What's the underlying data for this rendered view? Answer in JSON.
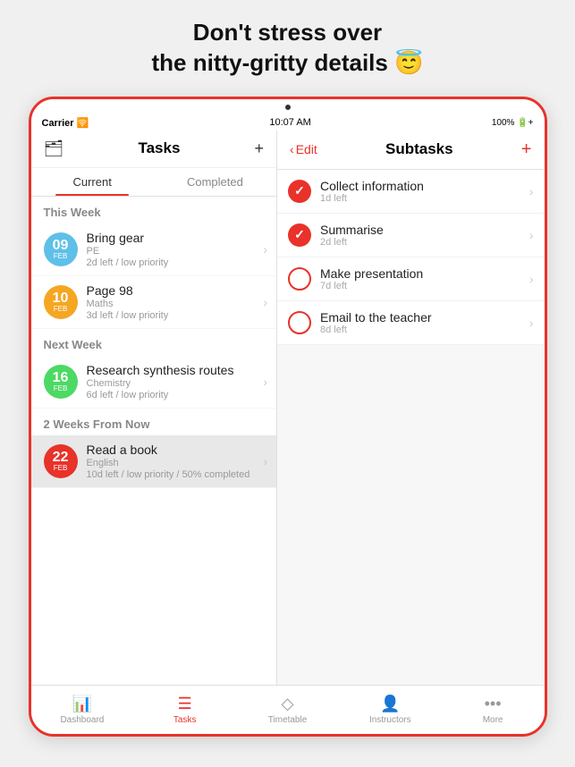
{
  "headline": {
    "line1": "Don't stress over",
    "line2": "the nitty-gritty details 😇"
  },
  "status_bar": {
    "carrier": "Carrier 🛜",
    "time": "10:07 AM",
    "battery": "100% 🔋+"
  },
  "left_panel": {
    "title": "Tasks",
    "tabs": [
      {
        "label": "Current",
        "active": true
      },
      {
        "label": "Completed",
        "active": false
      }
    ],
    "sections": [
      {
        "heading": "This Week",
        "tasks": [
          {
            "day": "09",
            "month": "Feb",
            "color": "#5ec0e8",
            "title": "Bring gear",
            "subtitle": "PE",
            "detail": "2d left / low priority"
          },
          {
            "day": "10",
            "month": "Feb",
            "color": "#f5a623",
            "title": "Page 98",
            "subtitle": "Maths",
            "detail": "3d left / low priority"
          }
        ]
      },
      {
        "heading": "Next Week",
        "tasks": [
          {
            "day": "16",
            "month": "Feb",
            "color": "#4cd964",
            "title": "Research synthesis routes",
            "subtitle": "Chemistry",
            "detail": "6d left / low priority"
          }
        ]
      },
      {
        "heading": "2 Weeks From Now",
        "tasks": [
          {
            "day": "22",
            "month": "Feb",
            "color": "#e8322a",
            "title": "Read a book",
            "subtitle": "English",
            "detail": "10d left / low priority / 50% completed",
            "selected": true
          }
        ]
      }
    ]
  },
  "right_panel": {
    "edit_label": "Edit",
    "title": "Subtasks",
    "add_label": "+",
    "subtasks": [
      {
        "title": "Collect information",
        "time": "1d left",
        "checked": true
      },
      {
        "title": "Summarise",
        "time": "2d left",
        "checked": true
      },
      {
        "title": "Make presentation",
        "time": "7d left",
        "checked": false
      },
      {
        "title": "Email to the teacher",
        "time": "8d left",
        "checked": false
      }
    ]
  },
  "bottom_nav": {
    "items": [
      {
        "icon": "📊",
        "label": "Dashboard",
        "active": false
      },
      {
        "icon": "☰",
        "label": "Tasks",
        "active": true
      },
      {
        "icon": "◇",
        "label": "Timetable",
        "active": false
      },
      {
        "icon": "👤",
        "label": "Instructors",
        "active": false
      },
      {
        "icon": "•••",
        "label": "More",
        "active": false
      }
    ]
  }
}
